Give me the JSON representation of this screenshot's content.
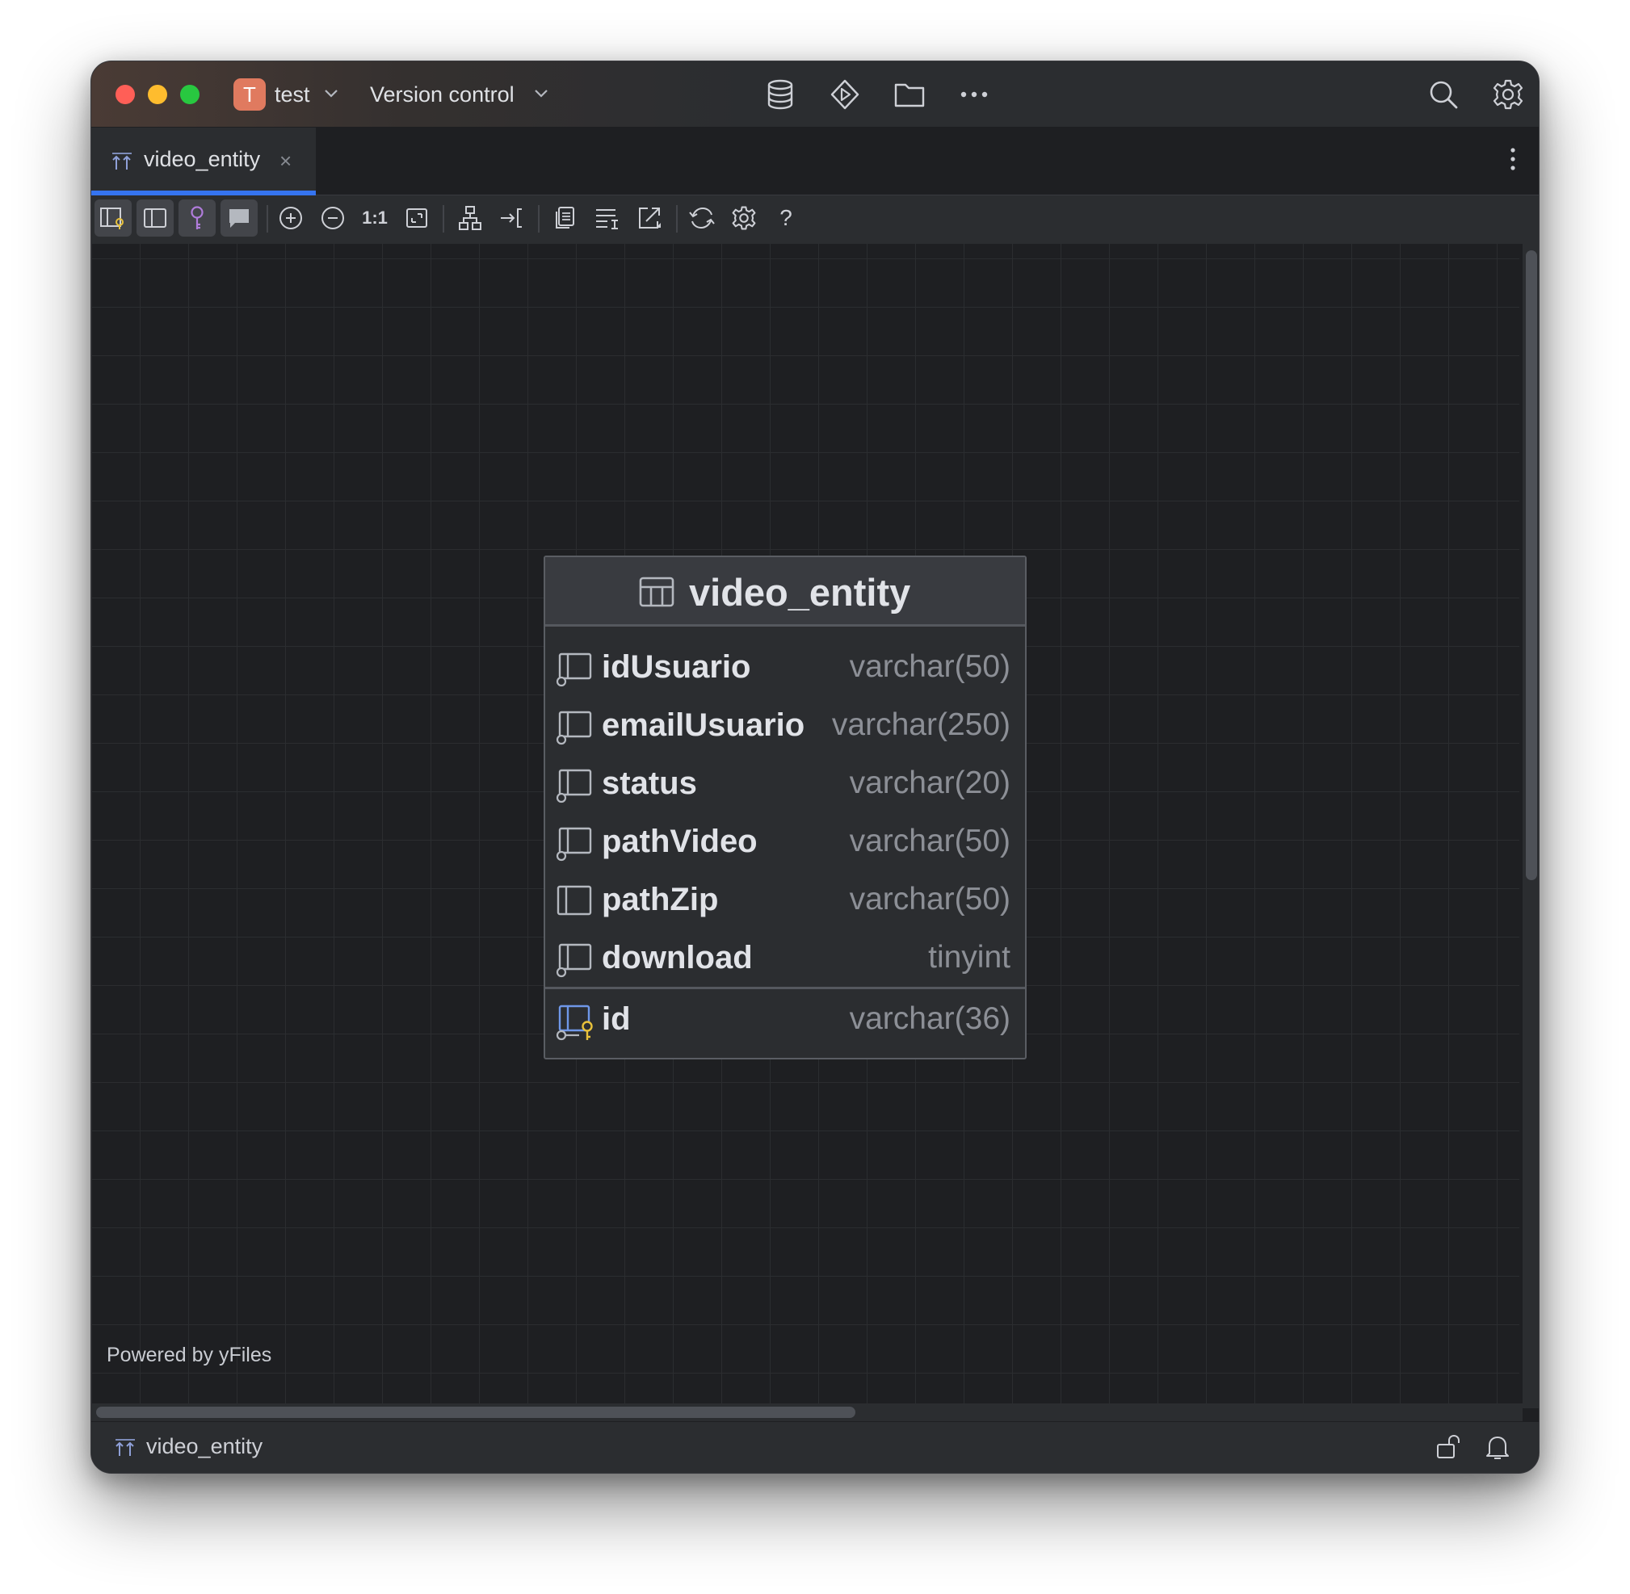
{
  "titlebar": {
    "project_initial": "T",
    "project_name": "test",
    "vcs_label": "Version control",
    "icons": [
      "database-icon",
      "run-icon",
      "folder-icon",
      "more-icon",
      "search-icon",
      "settings-icon"
    ]
  },
  "tabs": [
    {
      "label": "video_entity",
      "close": "×",
      "active": true
    }
  ],
  "toolbar": {
    "actual_size_label": "1:1",
    "help_label": "?"
  },
  "canvas": {
    "powered_by": "Powered by yFiles"
  },
  "entity": {
    "name": "video_entity",
    "columns": [
      {
        "name": "idUsuario",
        "type": "varchar(50)",
        "icon": "column-nullable-icon"
      },
      {
        "name": "emailUsuario",
        "type": "varchar(250)",
        "icon": "column-nullable-icon"
      },
      {
        "name": "status",
        "type": "varchar(20)",
        "icon": "column-nullable-icon"
      },
      {
        "name": "pathVideo",
        "type": "varchar(50)",
        "icon": "column-nullable-icon"
      },
      {
        "name": "pathZip",
        "type": "varchar(50)",
        "icon": "column-icon"
      },
      {
        "name": "download",
        "type": "tinyint",
        "icon": "column-nullable-icon"
      }
    ],
    "key_column": {
      "name": "id",
      "type": "varchar(36)",
      "icon": "primary-key-icon"
    }
  },
  "statusbar": {
    "label": "video_entity"
  },
  "colors": {
    "accent": "#3574f0",
    "background": "#1e1f22",
    "panel": "#2b2d30",
    "project_badge": "#e07a5f",
    "key_yellow": "#e8c13b",
    "diagram_purple": "#b07cdb"
  }
}
